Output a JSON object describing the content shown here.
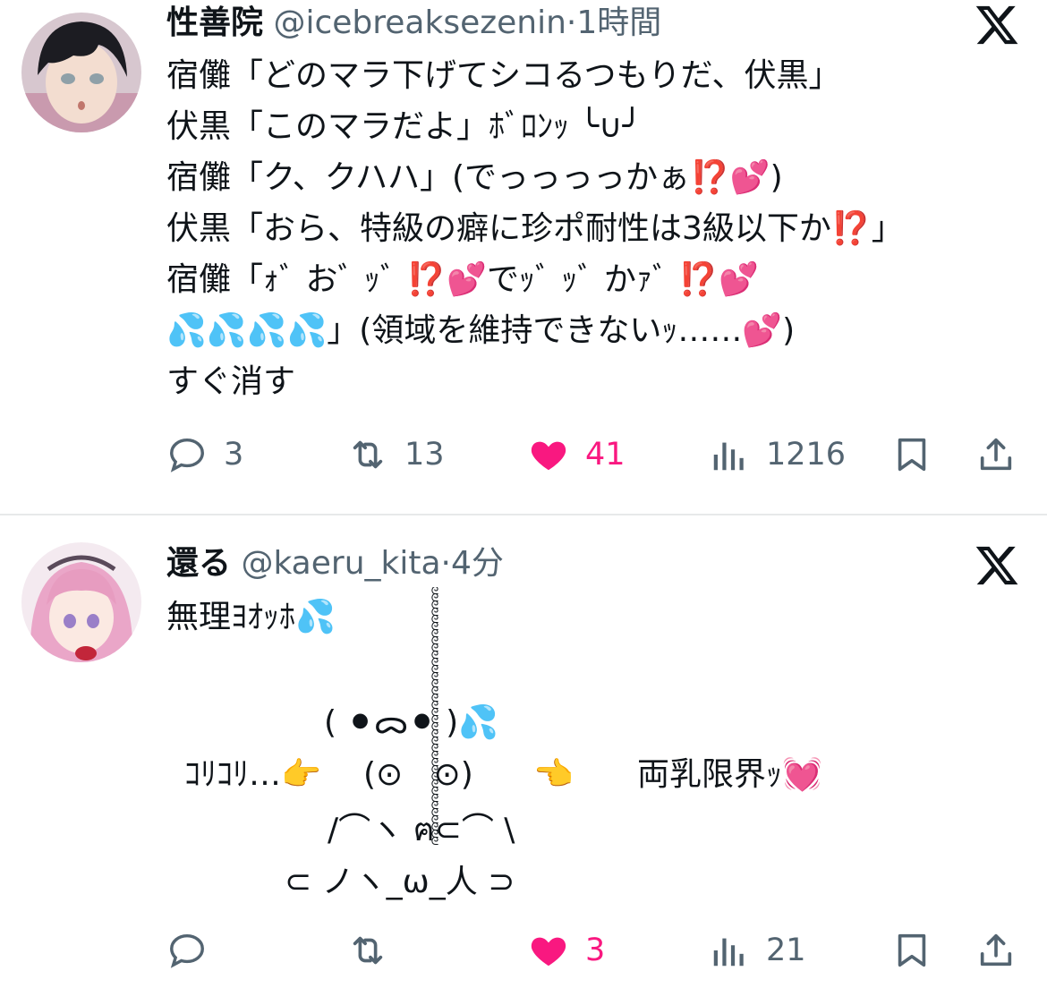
{
  "tweets": [
    {
      "name": "性善院",
      "handle": "@icebreaksezenin",
      "separator": "·",
      "time": "1時間",
      "lines": [
        "宿儺「どのマラ下げてシコるつもりだ、伏黒」",
        "伏黒「このマラだよ」ﾎﾞﾛﾝｯ ╰∪╯",
        "宿儺「ク、クハハ」(でっっっっかぁ⁉️💕)",
        "伏黒「おら、特級の癖に珍ポ耐性は3級以下か⁉️」",
        "宿儺「ｫﾞ おﾞ ｯﾞ ⁉️💕でｯﾞ ｯﾞ かｧﾞ ⁉️💕",
        "💦💦💦💦」(領域を維持できないｯ……💕)",
        "すぐ消す"
      ],
      "actions": {
        "reply": "3",
        "retweet": "13",
        "like": "41",
        "views": "1216"
      }
    },
    {
      "name": "還る",
      "handle": "@kaeru_kita",
      "separator": "·",
      "time": "4分",
      "first_line": "無理ﾖｵｯﾎ💦",
      "art": {
        "eyes": "( ⚫︎ᯅ⚫︎ )💦",
        "left_label": "ｺﾘｺﾘ…👉",
        "chest": "(⊙   ⊙)",
        "right_hand": "👈",
        "right_label": "両乳限界ｯ💓",
        "arms": "/⌒ヽ ฅ⊂⌒ \\",
        "bottom": "⊂ ノヽ_ω_人 ⊃"
      },
      "actions": {
        "reply": "",
        "retweet": "",
        "like": "3",
        "views": "21"
      }
    }
  ],
  "colors": {
    "like": "#f91880",
    "text": "#0f1419",
    "muted": "#536471",
    "divider": "#e7e9ea"
  }
}
